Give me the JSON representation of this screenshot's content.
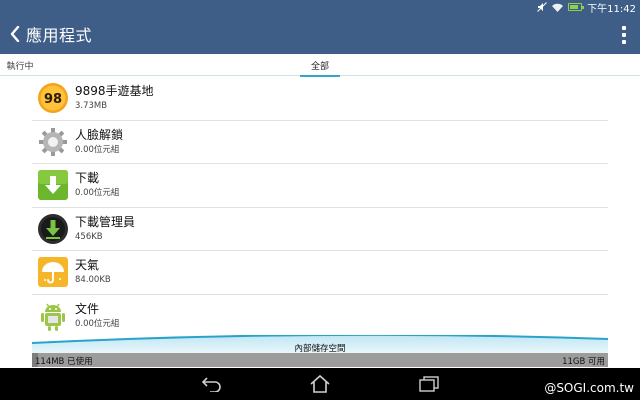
{
  "status_bar": {
    "time": "下午11:42",
    "icons": [
      "mute-icon",
      "wifi-icon",
      "battery-charging-icon"
    ]
  },
  "action_bar": {
    "title": "應用程式",
    "back_icon": "chevron-left-icon",
    "menu_icon": "overflow-menu-icon"
  },
  "tabs": [
    {
      "label": "執行中",
      "selected": false
    },
    {
      "label": "全部",
      "selected": true
    }
  ],
  "apps": [
    {
      "name": "9898手遊基地",
      "size": "3.73MB",
      "icon": "9898-game-icon"
    },
    {
      "name": "人臉解鎖",
      "size": "0.00位元組",
      "icon": "face-unlock-gear-icon"
    },
    {
      "name": "下載",
      "size": "0.00位元組",
      "icon": "download-icon"
    },
    {
      "name": "下載管理員",
      "size": "456KB",
      "icon": "download-manager-icon"
    },
    {
      "name": "天氣",
      "size": "84.00KB",
      "icon": "weather-umbrella-icon"
    },
    {
      "name": "文件",
      "size": "0.00位元組",
      "icon": "android-documents-icon"
    }
  ],
  "storage": {
    "label": "內部儲存空間",
    "used": "114MB 已使用",
    "available": "11GB 可用",
    "used_fraction": 0.01
  },
  "nav_bar": {
    "icons": [
      "back-icon",
      "home-icon",
      "recents-icon"
    ]
  },
  "watermark": "@SOGI.com.tw",
  "colors": {
    "action_bar": "#3f5e87",
    "tab_indicator": "#2fa7c6",
    "nav_bar": "#000000"
  }
}
